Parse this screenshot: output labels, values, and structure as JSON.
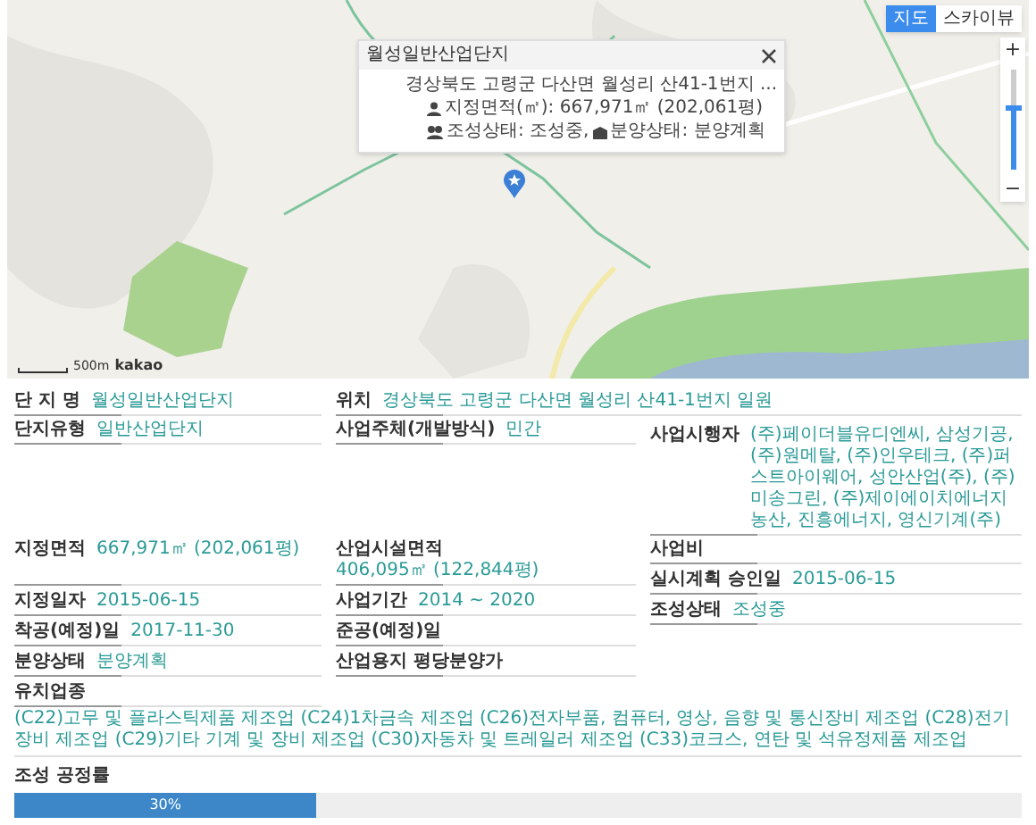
{
  "map": {
    "kind": "picture",
    "map_types": [
      {
        "label": "지도",
        "selected": true
      },
      {
        "label": "스카이뷰",
        "selected": false
      }
    ],
    "zoom_in": "+",
    "zoom_out": "−",
    "zoom_slider": {
      "level": 0.6
    },
    "scale": "500m",
    "logo": "kakao",
    "popup": {
      "title": "월성일반산업단지",
      "address": "경상북도 고령군 다산면 월성리 산41-1번지 ...",
      "area": "지정면적(㎡): 667,971㎡ (202,061평)",
      "statuses": [
        "조성상태: 조성중,",
        "분양상태: 분양계획"
      ]
    }
  },
  "name": {
    "label": "단 지 명",
    "value": "월성일반산업단지"
  },
  "location": {
    "label": "위치",
    "value": "경상북도 고령군 다산면 월성리 산41-1번지 일원"
  },
  "type_row": [
    {
      "label": "단지유형",
      "value": "일반산업단지"
    },
    {
      "label": "사업주체(개발방식)",
      "value": "민간"
    }
  ],
  "developer": {
    "label": "사업시행자",
    "value": "(주)페이더블유디엔씨, 삼성기공, (주)원메탈, (주)인우테크, (주)퍼스트아이웨어, 성안산업(주), (주)미송그린, (주)제이에이치에너지농산, 진흥에너지, 영신기계(주)"
  },
  "grid": [
    [
      {
        "label": "지정면적",
        "value": "667,971㎡ (202,061평)"
      },
      {
        "label": "산업시설면적",
        "value": "406,095㎡ (122,844평)"
      }
    ],
    [
      {
        "label": "지정일자",
        "value": "2015-06-15"
      },
      {
        "label": "사업기간",
        "value": "2014 ~ 2020"
      }
    ],
    [
      {
        "label": "착공(예정)일",
        "value": "2017-11-30"
      },
      {
        "label": "준공(예정)일"
      }
    ],
    [
      {
        "label": "분양상태",
        "value": "분양계획"
      },
      {
        "label": "산업용지 평당분양가"
      }
    ]
  ],
  "right": [
    {
      "label": "사업비"
    },
    {
      "label": "실시계획 승인일",
      "value": "2015-06-15"
    },
    {
      "label": "조성상태",
      "value": "조성중"
    }
  ],
  "industries": {
    "label": "유치업종",
    "text": "(C22)고무 및 플라스틱제품 제조업 (C24)1차금속 제조업 (C26)전자부품, 컴퓨터, 영상, 음향 및 통신장비 제조업 (C28)전기장비 제조업 (C29)기타 기계 및 장비 제조업 (C30)자동차 및 트레일러 제조업 (C33)코크스, 연탄 및 석유정제품 제조업"
  },
  "progress": {
    "label": "조성 공정률",
    "level": 0.3,
    "reading": "30%"
  }
}
